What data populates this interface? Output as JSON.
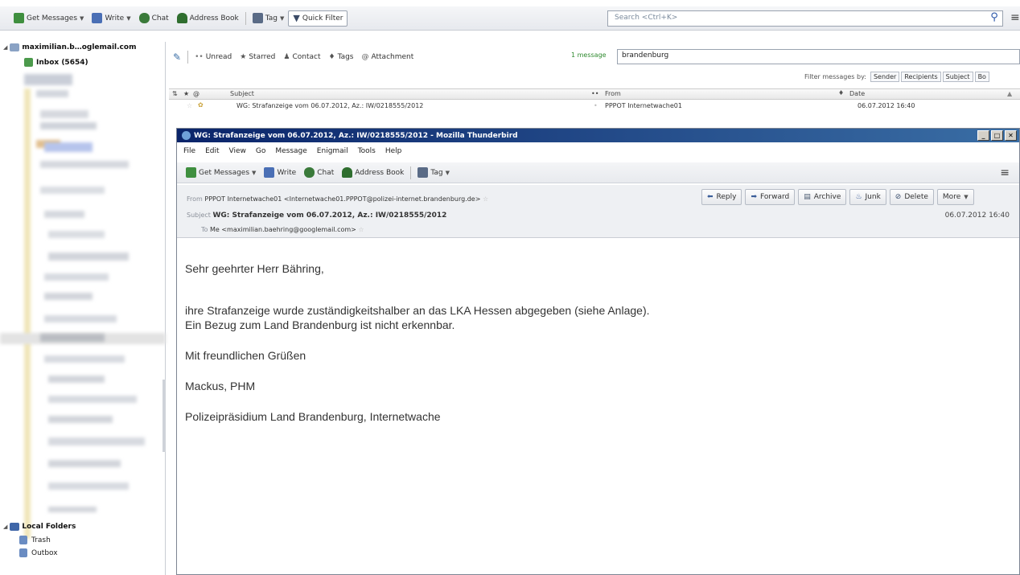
{
  "toolbar": {
    "get_messages": "Get Messages",
    "write": "Write",
    "chat": "Chat",
    "address_book": "Address Book",
    "tag": "Tag",
    "quick_filter": "Quick Filter",
    "search_placeholder": "Search <Ctrl+K>"
  },
  "folders": {
    "account": "maximilian.b…oglemail.com",
    "inbox": "Inbox (5654)",
    "local_folders": "Local Folders",
    "trash": "Trash",
    "outbox": "Outbox"
  },
  "quick_filter_bar": {
    "unread": "Unread",
    "starred": "Starred",
    "contact": "Contact",
    "tags": "Tags",
    "attachment": "Attachment",
    "count": "1 message",
    "search_value": "brandenburg",
    "filter_by_label": "Filter messages by:",
    "filter_sender": "Sender",
    "filter_recipients": "Recipients",
    "filter_subject": "Subject",
    "filter_body": "Bo"
  },
  "thread_pane": {
    "col_subject": "Subject",
    "col_from": "From",
    "col_date": "Date",
    "row_subject": "WG: Strafanzeige vom 06.07.2012, Az.: IW/0218555/2012",
    "row_from": "PPPOT Internetwache01",
    "row_date": "06.07.2012 16:40"
  },
  "message_window": {
    "title": "WG: Strafanzeige vom 06.07.2012, Az.: IW/0218555/2012 - Mozilla Thunderbird",
    "menu": [
      "File",
      "Edit",
      "View",
      "Go",
      "Message",
      "Enigmail",
      "Tools",
      "Help"
    ],
    "toolbar": {
      "get_messages": "Get Messages",
      "write": "Write",
      "chat": "Chat",
      "address_book": "Address Book",
      "tag": "Tag"
    },
    "header": {
      "from_label": "From",
      "from_value": "PPPOT Internetwache01 <Internetwache01.PPPOT@polizei-internet.brandenburg.de>",
      "subject_label": "Subject",
      "subject_value": "WG: Strafanzeige vom 06.07.2012, Az.: IW/0218555/2012",
      "to_label": "To",
      "to_value": "Me <maximilian.baehring@googlemail.com>",
      "date": "06.07.2012 16:40"
    },
    "actions": {
      "reply": "Reply",
      "forward": "Forward",
      "archive": "Archive",
      "junk": "Junk",
      "delete": "Delete",
      "more": "More"
    },
    "body": {
      "greeting": "Sehr geehrter Herr Bähring,",
      "line1": "ihre Strafanzeige wurde zuständigkeitshalber an das LKA Hessen abgegeben (siehe Anlage).",
      "line2": "Ein Bezug zum Land Brandenburg ist nicht erkennbar.",
      "closing": "Mit freundlichen Grüßen",
      "signature_name": "Mackus, PHM",
      "signature_org": "Polizeipräsidium Land Brandenburg, Internetwache"
    }
  }
}
